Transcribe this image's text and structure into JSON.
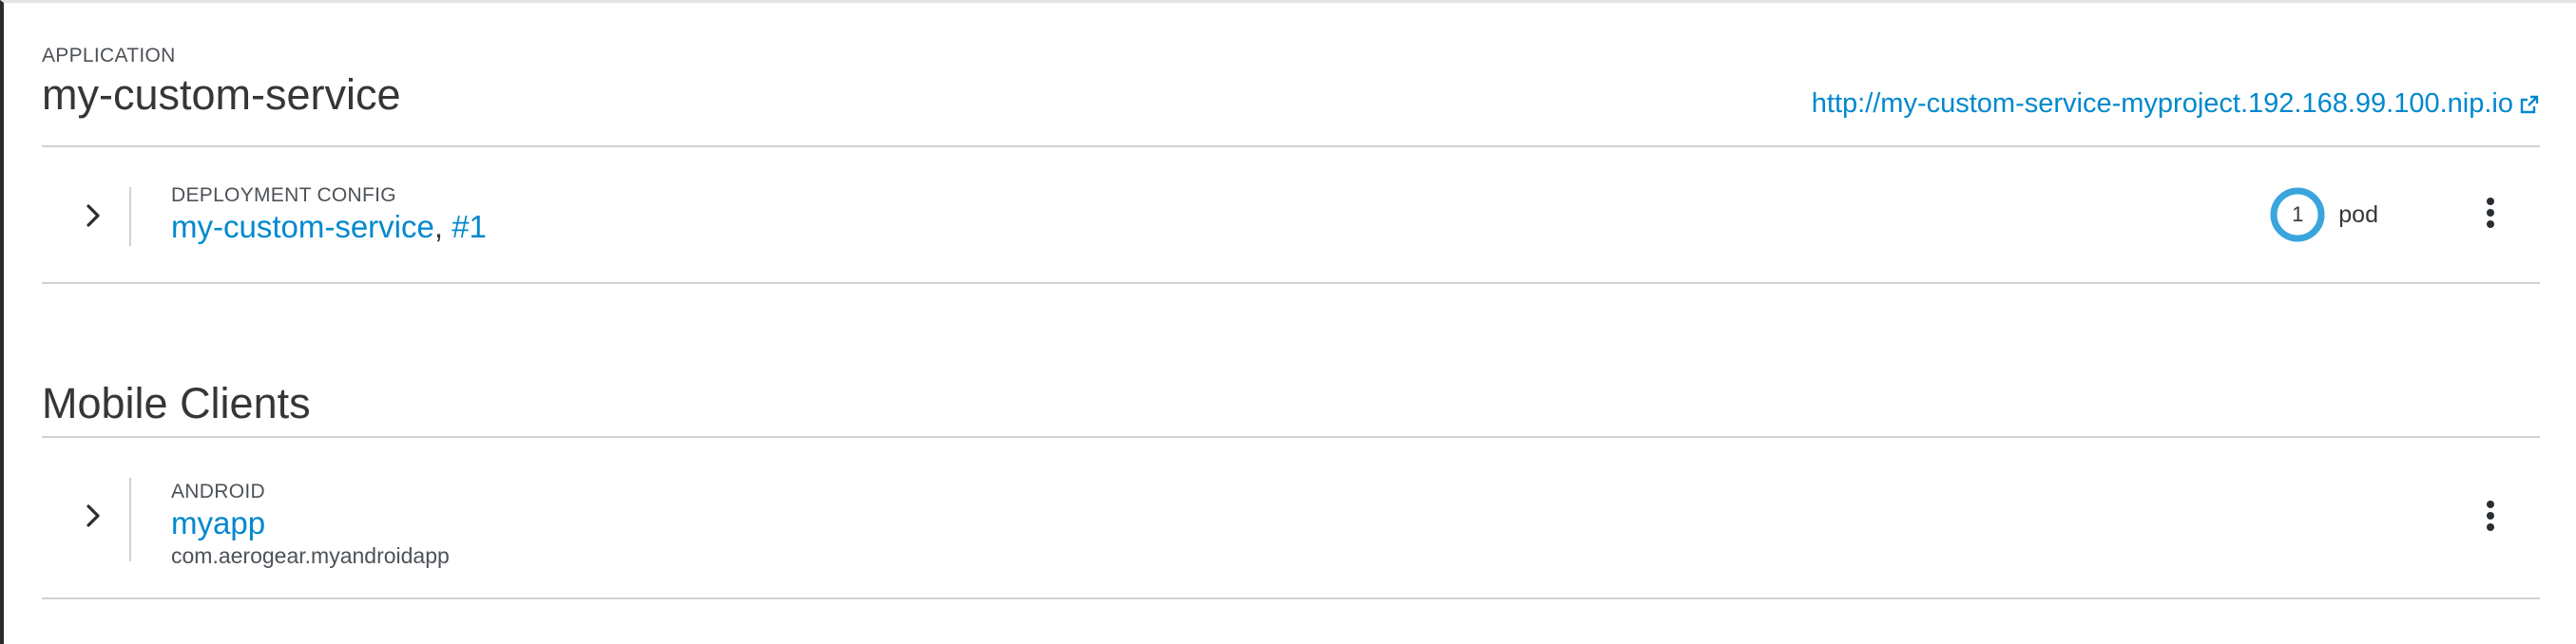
{
  "application": {
    "kicker": "APPLICATION",
    "name": "my-custom-service",
    "url": "http://my-custom-service-myproject.192.168.99.100.nip.io"
  },
  "deployment": {
    "kicker": "DEPLOYMENT CONFIG",
    "name": "my-custom-service",
    "separator": ", ",
    "version": "#1",
    "pod_count": "1",
    "pod_label": "pod"
  },
  "mobile_clients": {
    "title": "Mobile Clients",
    "items": [
      {
        "kicker": "ANDROID",
        "name": "myapp",
        "bundle_id": "com.aerogear.myandroidapp"
      }
    ]
  },
  "colors": {
    "link": "#0088ce",
    "pod_ring": "#39a5dc",
    "divider": "#d1d1d1"
  },
  "icons": {
    "expand": "chevron-right-icon",
    "external": "external-link-icon",
    "menu": "kebab-menu-icon"
  }
}
